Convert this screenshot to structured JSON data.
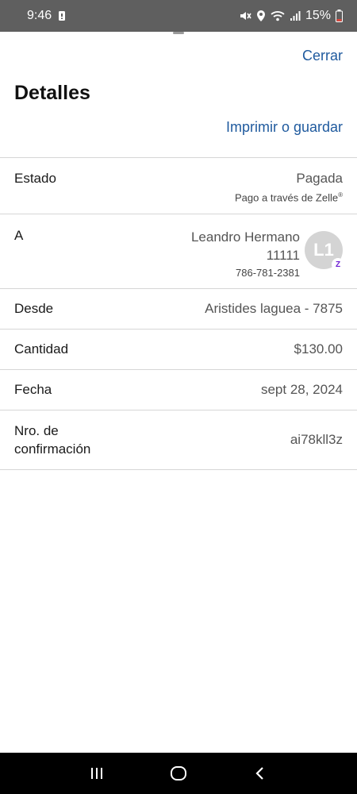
{
  "status_bar": {
    "time": "9:46",
    "battery": "15%",
    "icons": [
      "notification-icon",
      "mute-icon",
      "location-icon",
      "wifi-icon",
      "signal-icon",
      "battery-low-icon"
    ],
    "battery_color": "#e0453a"
  },
  "header": {
    "close_label": "Cerrar",
    "title": "Detalles",
    "print_label": "Imprimir o guardar"
  },
  "details": {
    "status": {
      "label": "Estado",
      "value": "Pagada",
      "sub_text": "Pago a través de Zelle",
      "sub_mark": "®"
    },
    "recipient": {
      "label": "A",
      "name": "Leandro Hermano",
      "number": "11111",
      "phone": "786-781-2381",
      "avatar_initials": "L1",
      "badge_glyph": "Z"
    },
    "from": {
      "label": "Desde",
      "value": "Aristides laguea - 7875"
    },
    "amount": {
      "label": "Cantidad",
      "value": "$130.00"
    },
    "date": {
      "label": "Fecha",
      "value": "sept 28, 2024"
    },
    "confirmation": {
      "label": "Nro. de confirmación",
      "value": "ai78kll3z"
    }
  },
  "colors": {
    "link": "#1f5a9e",
    "zelle": "#6d1ed4",
    "status_bar_bg": "#5f5f5f"
  },
  "nav": {
    "icons": [
      "recent-apps-icon",
      "home-icon",
      "back-icon"
    ]
  }
}
